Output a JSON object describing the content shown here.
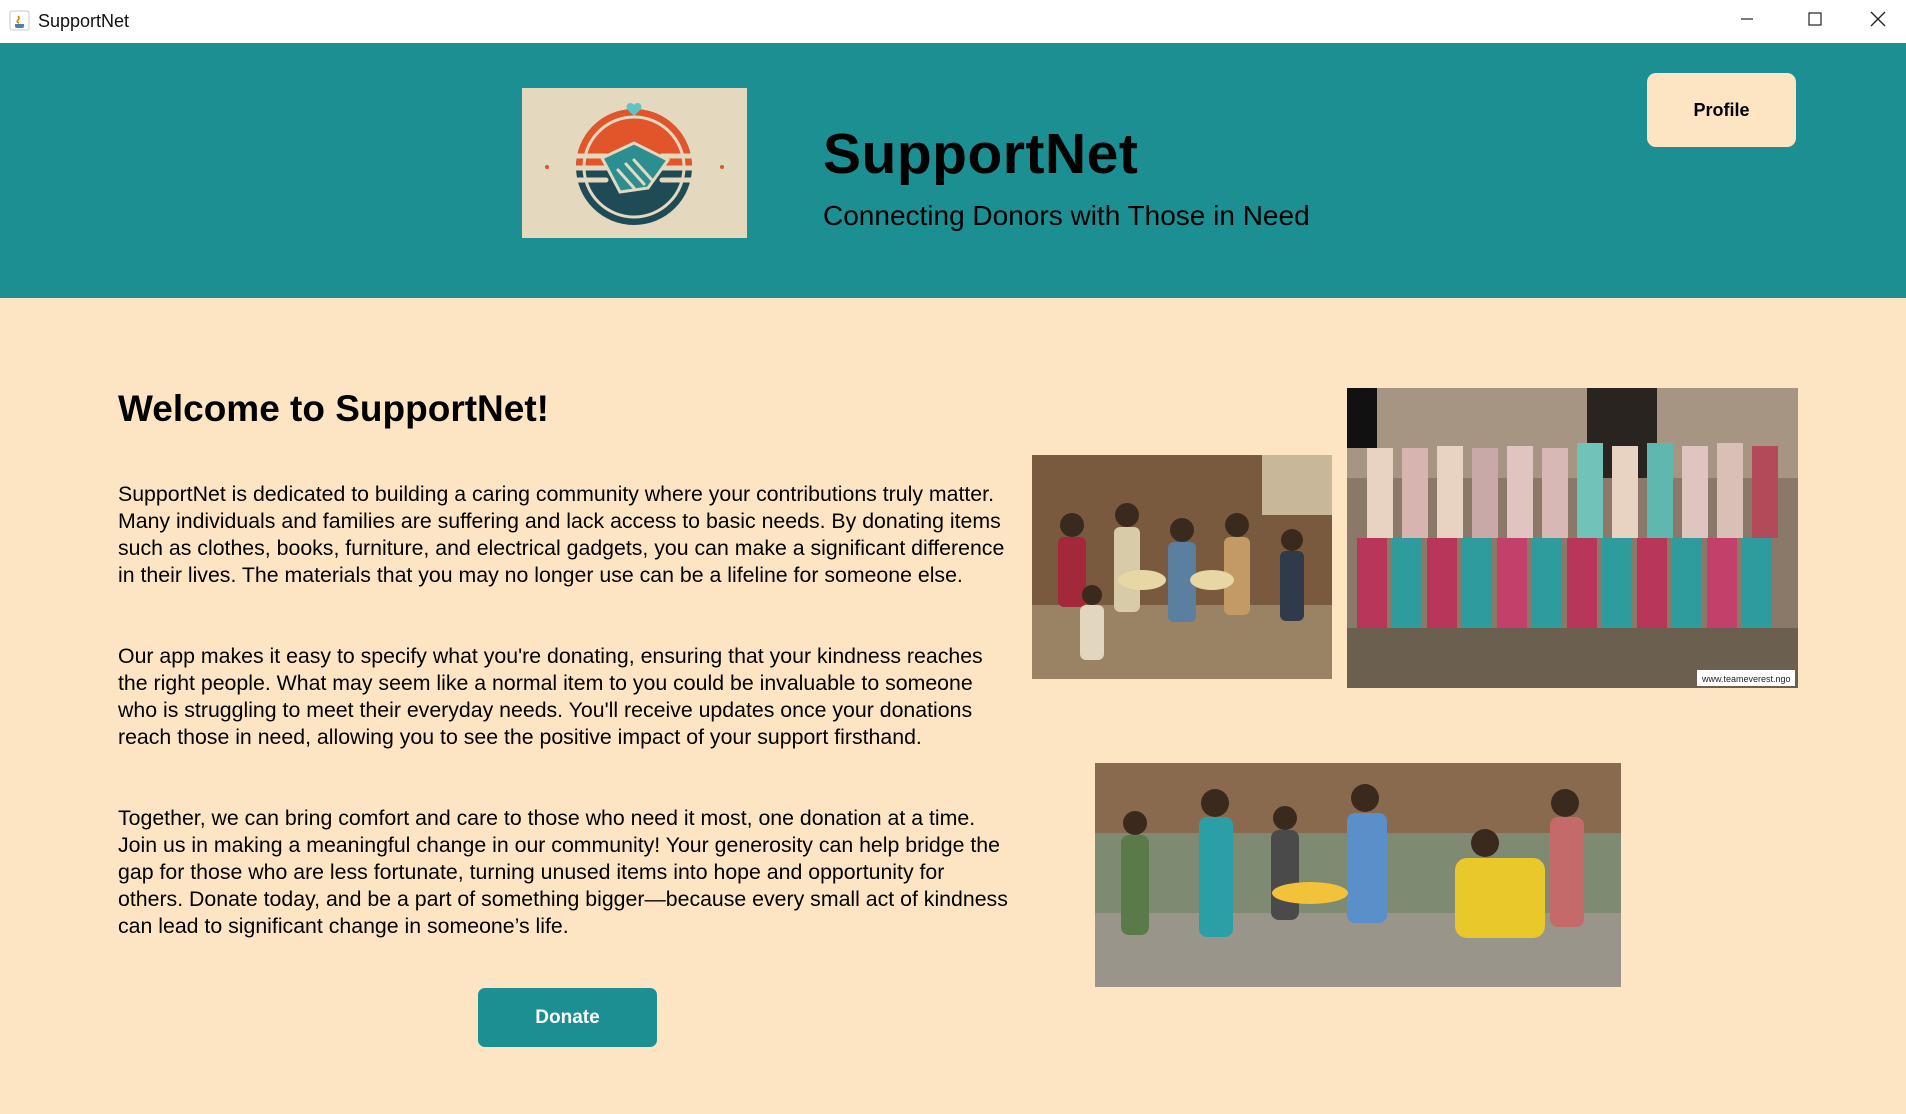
{
  "window": {
    "title": "SupportNet",
    "controls": [
      "minimize-icon",
      "maximize-icon",
      "close-icon"
    ]
  },
  "header": {
    "logo_icon": "handshake-heart-logo",
    "title": "SupportNet",
    "tagline": "Connecting Donors with Those in Need",
    "profile_label": "Profile"
  },
  "main": {
    "heading": "Welcome to SupportNet!",
    "paragraphs": [
      "SupportNet is dedicated to building a caring community where your contributions truly matter. Many individuals and families are suffering and lack access to basic needs. By donating items such as clothes, books, furniture, and electrical gadgets, you can make a significant difference in their lives. The materials that you may no longer use can be a lifeline for someone else.",
      "Our app makes it easy to specify what you're donating, ensuring that your kindness reaches the right people. What may seem like a normal item to you could be invaluable to someone who is struggling to meet their everyday needs. You'll receive updates once your donations reach those in need, allowing you to see the positive impact of your support firsthand.",
      "Together, we can bring comfort and care to those who need it most, one donation at a time. Join us in making a meaningful change in our community! Your generosity can help bridge the gap for those who are less fortunate, turning unused items into hope and opportunity for others. Donate today, and be a part of something bigger—because every small act of kindness can lead to significant change in someone’s life."
    ],
    "donate_label": "Donate"
  },
  "photos": {
    "photo2_watermark": "www.teameverest.ngo"
  },
  "colors": {
    "header_bg": "#1b8f91",
    "page_bg": "#fde5c4",
    "button_teal": "#1b8f91"
  }
}
